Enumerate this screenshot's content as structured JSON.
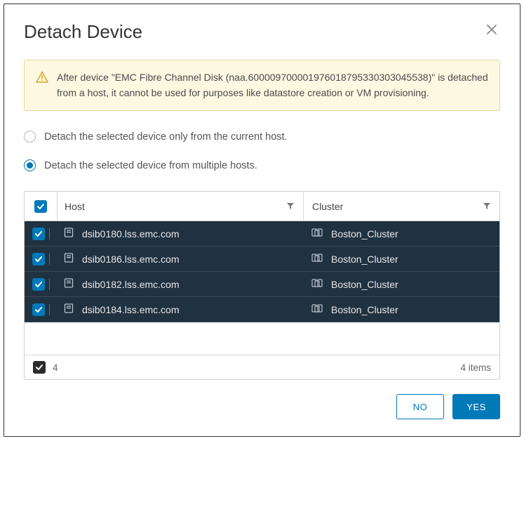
{
  "dialog": {
    "title": "Detach Device",
    "warning": "After device \"EMC Fibre Channel Disk (naa.600009700001976018795330303045538)\" is detached from a host, it cannot be used for purposes like datastore creation or VM provisioning.",
    "options": {
      "current_host": "Detach the selected device only from the current host.",
      "multiple_hosts": "Detach the selected device from multiple hosts."
    },
    "selected_option": "multiple_hosts"
  },
  "table": {
    "columns": {
      "host": "Host",
      "cluster": "Cluster"
    },
    "rows": [
      {
        "host": "dsib0180.lss.emc.com",
        "cluster": "Boston_Cluster",
        "checked": true
      },
      {
        "host": "dsib0186.lss.emc.com",
        "cluster": "Boston_Cluster",
        "checked": true
      },
      {
        "host": "dsib0182.lss.emc.com",
        "cluster": "Boston_Cluster",
        "checked": true
      },
      {
        "host": "dsib0184.lss.emc.com",
        "cluster": "Boston_Cluster",
        "checked": true
      }
    ],
    "footer": {
      "selected_count": "4",
      "items_label": "4 items"
    }
  },
  "actions": {
    "no": "NO",
    "yes": "YES"
  }
}
